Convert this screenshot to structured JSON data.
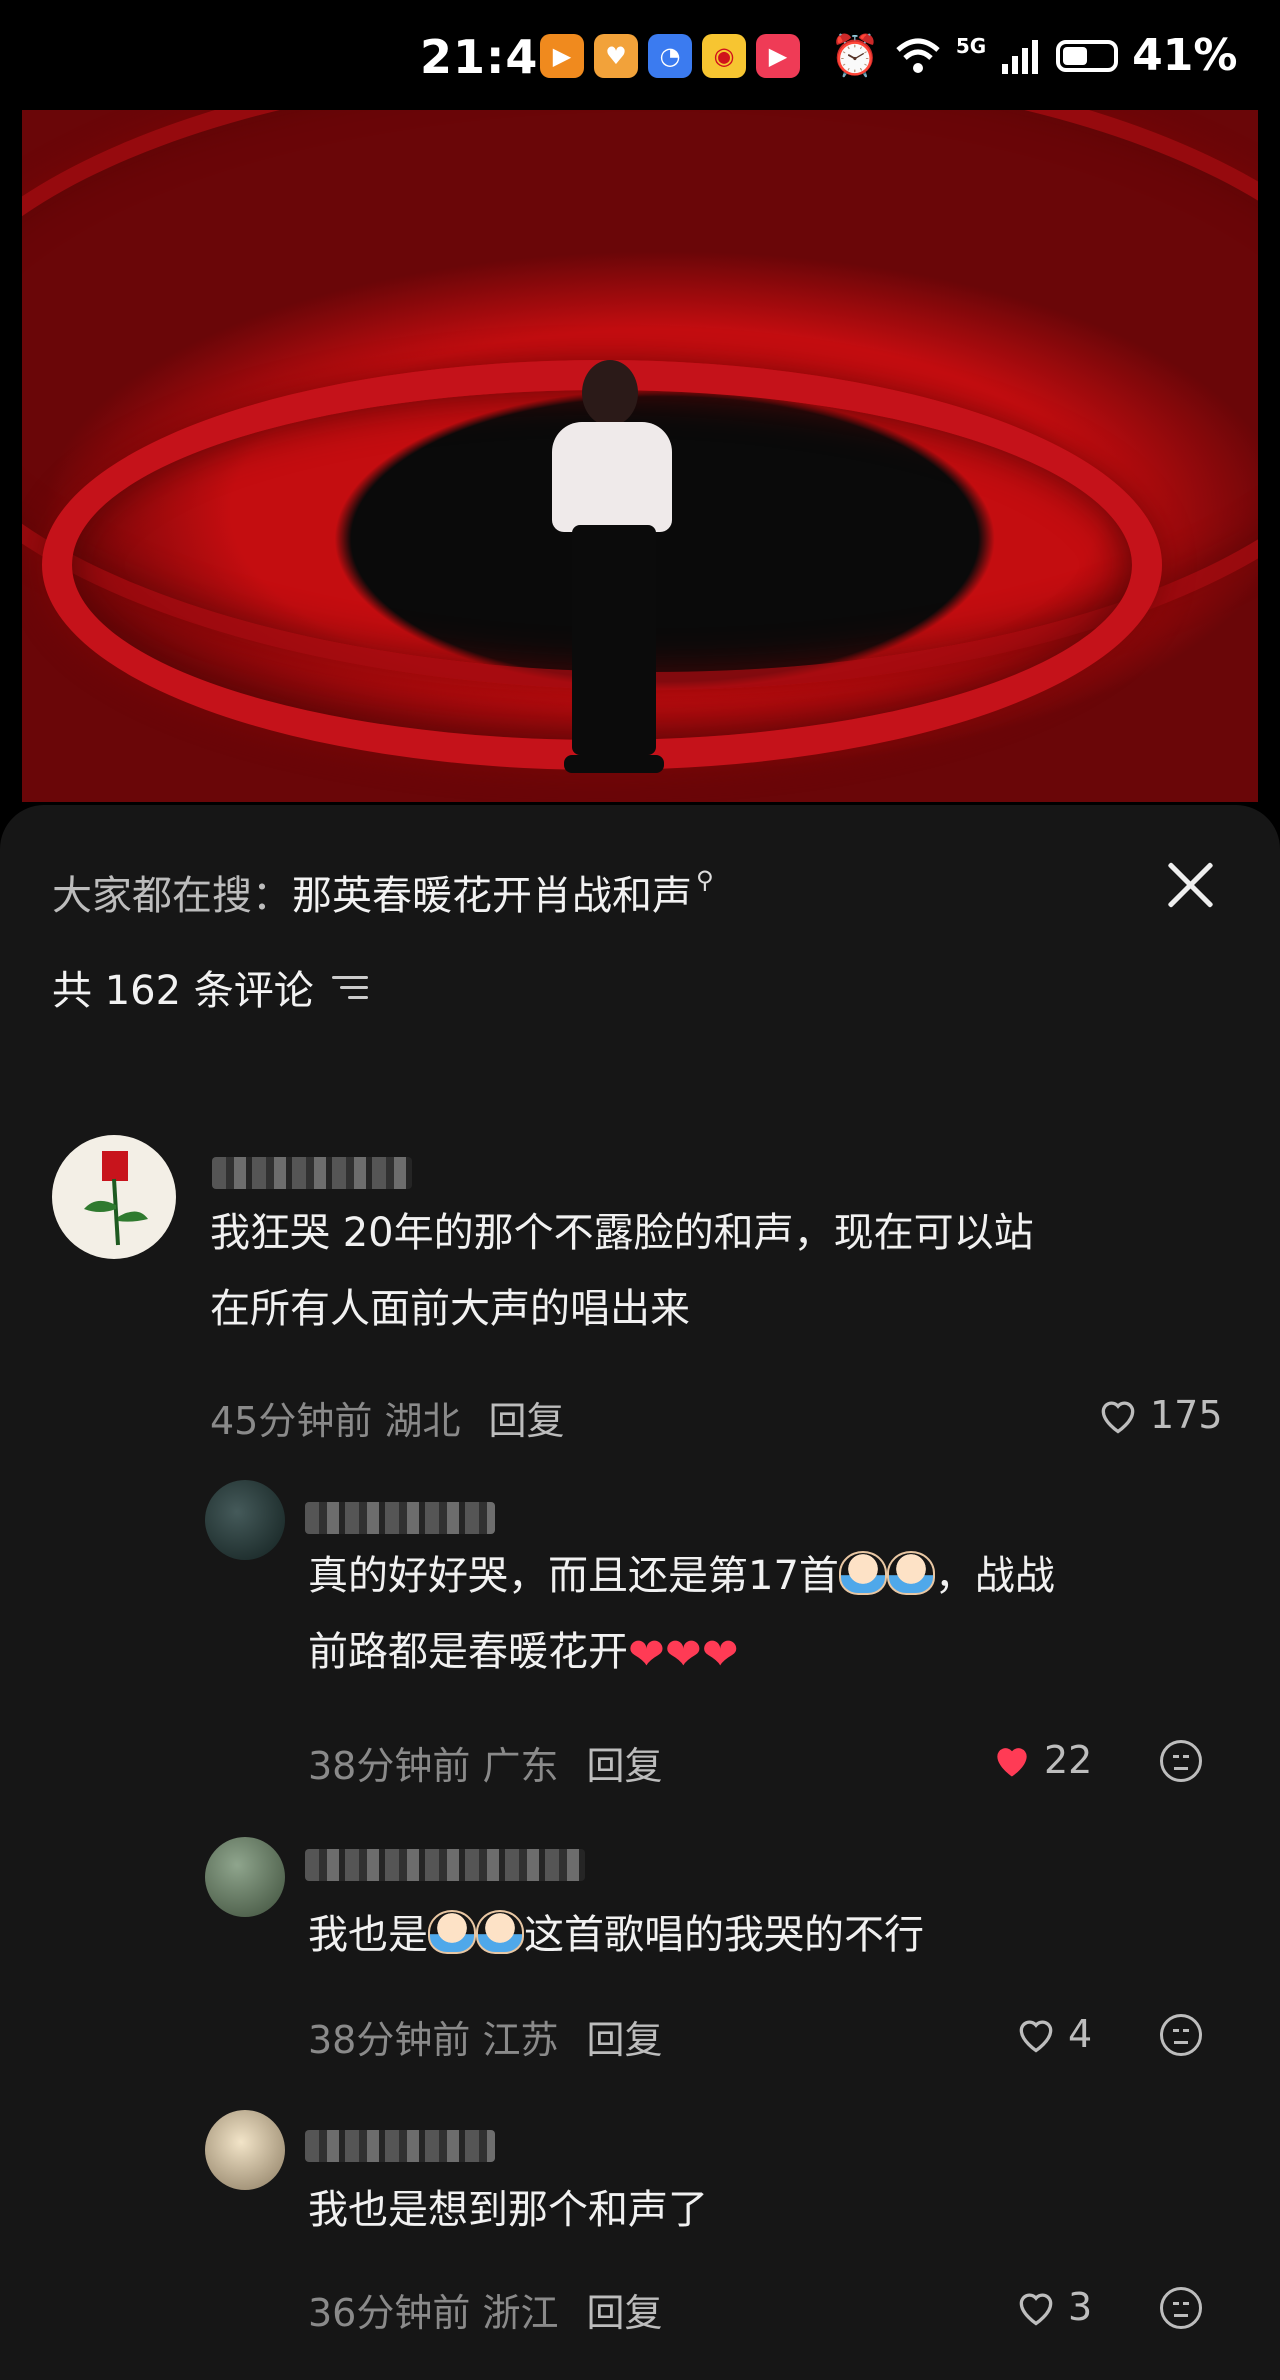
{
  "status_bar": {
    "time": "21:41",
    "network": "5G",
    "battery": "41%",
    "app_icons": [
      "play-icon",
      "heart-app-icon",
      "compass-app-icon",
      "weibo-icon",
      "video-app-icon"
    ],
    "system_icons": [
      "alarm-icon",
      "wifi-icon",
      "signal-icon",
      "battery-icon"
    ]
  },
  "search_hint": {
    "prefix": "大家都在搜：",
    "term": "那英春暖花开肖战和声"
  },
  "comment_count": "共 162 条评论",
  "comments": [
    {
      "text_line1": "我狂哭 20年的那个不露脸的和声，现在可以站",
      "text_line2": "在所有人面前大声的唱出来",
      "time": "45分钟前",
      "location": "湖北",
      "reply": "回复",
      "likes": "175",
      "liked": false
    },
    {
      "text_line1a": "真的好好哭，而且还是第17首",
      "text_line1b": "，战战",
      "text_line2": "前路都是春暖花开",
      "time": "38分钟前",
      "location": "广东",
      "reply": "回复",
      "likes": "22",
      "liked": true
    },
    {
      "text_a": "我也是",
      "text_b": "这首歌唱的我哭的不行",
      "time": "38分钟前",
      "location": "江苏",
      "reply": "回复",
      "likes": "4",
      "liked": false
    },
    {
      "text": "我也是想到那个和声了",
      "time": "36分钟前",
      "location": "浙江",
      "reply": "回复",
      "likes": "3",
      "liked": false
    }
  ],
  "colors": {
    "sheet_bg": "#161616",
    "liked_heart": "#ff3b55",
    "meta": "#8a8a8a"
  }
}
